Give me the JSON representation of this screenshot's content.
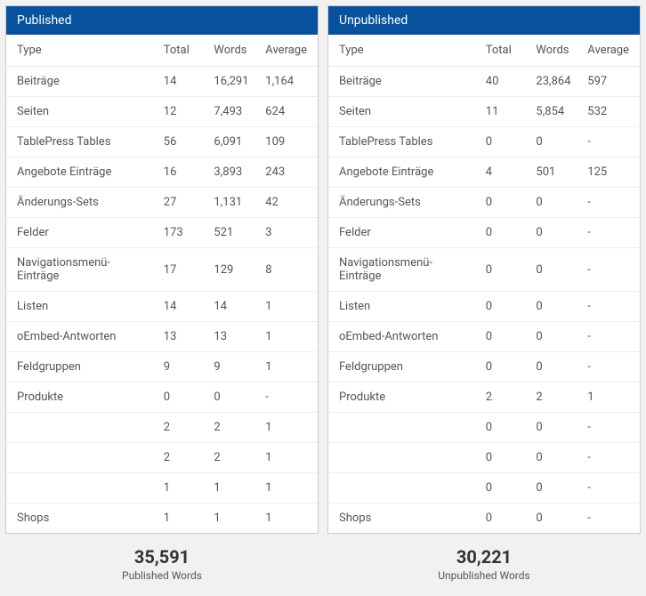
{
  "published": {
    "title": "Published",
    "columns": {
      "type": "Type",
      "total": "Total",
      "words": "Words",
      "average": "Average"
    },
    "rows": [
      {
        "type": "Beiträge",
        "total": "14",
        "words": "16,291",
        "average": "1,164"
      },
      {
        "type": "Seiten",
        "total": "12",
        "words": "7,493",
        "average": "624"
      },
      {
        "type": "TablePress Tables",
        "total": "56",
        "words": "6,091",
        "average": "109"
      },
      {
        "type": "Angebote Einträge",
        "total": "16",
        "words": "3,893",
        "average": "243"
      },
      {
        "type": "Änderungs-Sets",
        "total": "27",
        "words": "1,131",
        "average": "42"
      },
      {
        "type": "Felder",
        "total": "173",
        "words": "521",
        "average": "3"
      },
      {
        "type": "Navigationsmenü-Einträge",
        "total": "17",
        "words": "129",
        "average": "8"
      },
      {
        "type": "Listen",
        "total": "14",
        "words": "14",
        "average": "1"
      },
      {
        "type": "oEmbed-Antworten",
        "total": "13",
        "words": "13",
        "average": "1"
      },
      {
        "type": "Feldgruppen",
        "total": "9",
        "words": "9",
        "average": "1"
      },
      {
        "type": "Produkte",
        "total": "0",
        "words": "0",
        "average": "-"
      },
      {
        "type": "",
        "total": "2",
        "words": "2",
        "average": "1"
      },
      {
        "type": "",
        "total": "2",
        "words": "2",
        "average": "1"
      },
      {
        "type": "",
        "total": "1",
        "words": "1",
        "average": "1"
      },
      {
        "type": "Shops",
        "total": "1",
        "words": "1",
        "average": "1"
      }
    ],
    "summary_value": "35,591",
    "summary_label": "Published Words"
  },
  "unpublished": {
    "title": "Unpublished",
    "columns": {
      "type": "Type",
      "total": "Total",
      "words": "Words",
      "average": "Average"
    },
    "rows": [
      {
        "type": "Beiträge",
        "total": "40",
        "words": "23,864",
        "average": "597"
      },
      {
        "type": "Seiten",
        "total": "11",
        "words": "5,854",
        "average": "532"
      },
      {
        "type": "TablePress Tables",
        "total": "0",
        "words": "0",
        "average": "-"
      },
      {
        "type": "Angebote Einträge",
        "total": "4",
        "words": "501",
        "average": "125"
      },
      {
        "type": "Änderungs-Sets",
        "total": "0",
        "words": "0",
        "average": "-"
      },
      {
        "type": "Felder",
        "total": "0",
        "words": "0",
        "average": "-"
      },
      {
        "type": "Navigationsmenü-Einträge",
        "total": "0",
        "words": "0",
        "average": "-"
      },
      {
        "type": "Listen",
        "total": "0",
        "words": "0",
        "average": "-"
      },
      {
        "type": "oEmbed-Antworten",
        "total": "0",
        "words": "0",
        "average": "-"
      },
      {
        "type": "Feldgruppen",
        "total": "0",
        "words": "0",
        "average": "-"
      },
      {
        "type": "Produkte",
        "total": "2",
        "words": "2",
        "average": "1"
      },
      {
        "type": "",
        "total": "0",
        "words": "0",
        "average": "-"
      },
      {
        "type": "",
        "total": "0",
        "words": "0",
        "average": "-"
      },
      {
        "type": "",
        "total": "0",
        "words": "0",
        "average": "-"
      },
      {
        "type": "Shops",
        "total": "0",
        "words": "0",
        "average": "-"
      }
    ],
    "summary_value": "30,221",
    "summary_label": "Unpublished Words"
  }
}
